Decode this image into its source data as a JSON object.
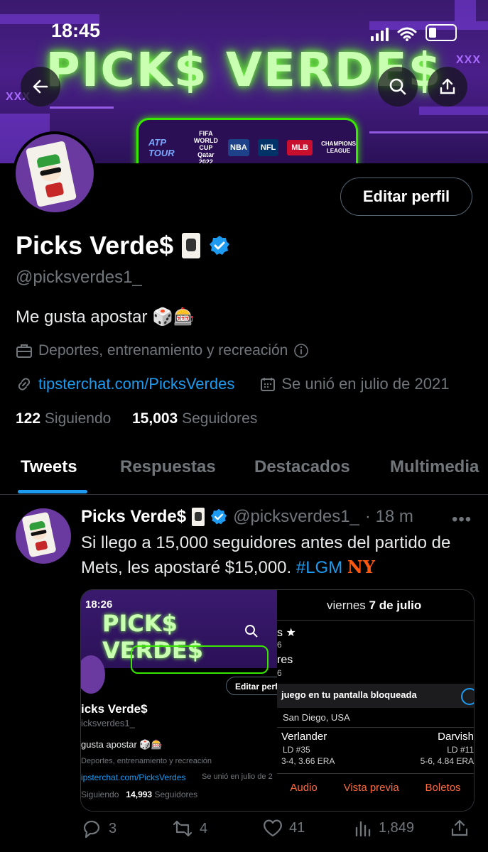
{
  "status_bar": {
    "time": "18:45"
  },
  "banner": {
    "title": "PICK$ VERDE$",
    "logos": [
      "ATP TOUR",
      "FIFA WORLD CUP Qatar 2022",
      "NBA",
      "NFL",
      "MLB",
      "CHAMPIONS LEAGUE"
    ],
    "decor_text": "XXX"
  },
  "profile": {
    "edit_button": "Editar perfil",
    "name": "Picks Verde$",
    "handle": "@picksverdes1_",
    "bio": "Me gusta apostar 🎲🎰",
    "category": "Deportes, entrenamiento y recreación",
    "link": "tipsterchat.com/PicksVerdes",
    "joined": "Se unió en julio de 2021",
    "following_count": "122",
    "following_label": "Siguiendo",
    "followers_count": "15,003",
    "followers_label": "Seguidores"
  },
  "tabs": [
    "Tweets",
    "Respuestas",
    "Destacados",
    "Multimedia"
  ],
  "tweet": {
    "name": "Picks Verde$",
    "handle": "@picksverdes1_",
    "time": "· 18 m",
    "text": "Si llego a 15,000 seguidores antes del partido de Mets, les apostaré $15,000. ",
    "hashtag": "#LGM",
    "replies": "3",
    "retweets": "4",
    "likes": "41",
    "views": "1,849"
  },
  "embedded": {
    "left": {
      "time": "18:26",
      "banner_title": "PICK$ VERDE$",
      "edit_button": "Editar perfi",
      "name": "icks Verde$",
      "handle": "icksverdes1_",
      "bio": "gusta apostar 🎲🎰",
      "category": "Deportes, entrenamiento y recreación",
      "link": "ipsterchat.com/PicksVerdes",
      "joined": "Se unió en julio de 2",
      "following_label": "Siguiendo",
      "followers_count": "14,993",
      "followers_label": "Seguidores"
    },
    "right": {
      "date_prefix": "viernes ",
      "date_bold": "7 de julio",
      "row1": "s ★",
      "row1_sub": "6",
      "row2": "res",
      "row2_sub": "6",
      "notice": "juego en tu pantalla bloqueada",
      "location": "San Diego, USA",
      "pitcher1": "Verlander",
      "pitcher1_ld": "LD #35",
      "pitcher1_stats": "3-4, 3.66 ERA",
      "pitcher2": "Darvish",
      "pitcher2_ld": "LD #11",
      "pitcher2_stats": "5-6, 4.84 ERA",
      "actions": [
        "Audio",
        "Vista previa",
        "Boletos"
      ]
    }
  },
  "colors": {
    "accent": "#1d9bf0",
    "muted": "#71767b",
    "neon_green": "#39e600",
    "banner_purple": "#4b1f8a"
  }
}
